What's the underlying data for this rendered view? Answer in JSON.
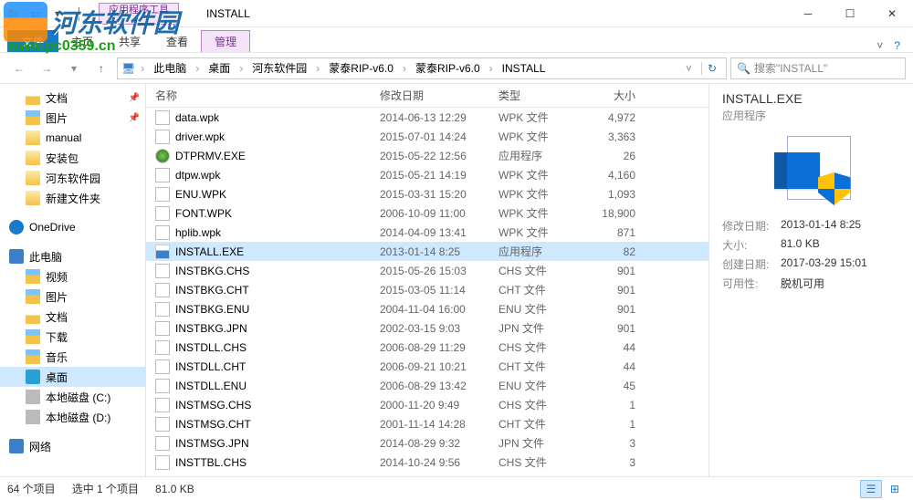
{
  "watermark": {
    "brand": "河东软件园",
    "url": "www.pc0359.cn"
  },
  "titlebar": {
    "context_tab_top": "应用程序工具",
    "window_title": "INSTALL"
  },
  "ribbon": {
    "file": "文件",
    "tabs": [
      "主页",
      "共享",
      "查看"
    ],
    "context_tab": "管理"
  },
  "breadcrumb": {
    "items": [
      "此电脑",
      "桌面",
      "河东软件园",
      "蒙泰RIP-v6.0",
      "蒙泰RIP-v6.0",
      "INSTALL"
    ]
  },
  "search": {
    "placeholder": "搜索\"INSTALL\""
  },
  "tree": {
    "group_quickaccess": [
      {
        "label": "文档",
        "icon": "text-folder",
        "pinned": true
      },
      {
        "label": "图片",
        "icon": "picture-folder",
        "pinned": true
      },
      {
        "label": "manual",
        "icon": "folder-icon",
        "pinned": false
      },
      {
        "label": "安装包",
        "icon": "folder-icon",
        "pinned": false
      },
      {
        "label": "河东软件园",
        "icon": "folder-icon",
        "pinned": false
      },
      {
        "label": "新建文件夹",
        "icon": "folder-icon",
        "pinned": false
      }
    ],
    "onedrive": "OneDrive",
    "thispc": "此电脑",
    "thispc_children": [
      {
        "label": "视频",
        "icon": "video-folder"
      },
      {
        "label": "图片",
        "icon": "picture-folder"
      },
      {
        "label": "文档",
        "icon": "text-folder"
      },
      {
        "label": "下载",
        "icon": "download-folder"
      },
      {
        "label": "音乐",
        "icon": "music-folder"
      },
      {
        "label": "桌面",
        "icon": "desktop-icon",
        "selected": true
      },
      {
        "label": "本地磁盘 (C:)",
        "icon": "disk-icon"
      },
      {
        "label": "本地磁盘 (D:)",
        "icon": "disk-icon"
      }
    ],
    "network": "网络"
  },
  "columns": {
    "name": "名称",
    "date": "修改日期",
    "type": "类型",
    "size": "大小"
  },
  "files": [
    {
      "name": "data.wpk",
      "date": "2014-06-13 12:29",
      "type": "WPK 文件",
      "size": "4,972",
      "icon": "wpk"
    },
    {
      "name": "driver.wpk",
      "date": "2015-07-01 14:24",
      "type": "WPK 文件",
      "size": "3,363",
      "icon": "wpk"
    },
    {
      "name": "DTPRMV.EXE",
      "date": "2015-05-22 12:56",
      "type": "应用程序",
      "size": "26",
      "icon": "dtprmv"
    },
    {
      "name": "dtpw.wpk",
      "date": "2015-05-21 14:19",
      "type": "WPK 文件",
      "size": "4,160",
      "icon": "wpk"
    },
    {
      "name": "ENU.WPK",
      "date": "2015-03-31 15:20",
      "type": "WPK 文件",
      "size": "1,093",
      "icon": "wpk"
    },
    {
      "name": "FONT.WPK",
      "date": "2006-10-09 11:00",
      "type": "WPK 文件",
      "size": "18,900",
      "icon": "wpk"
    },
    {
      "name": "hplib.wpk",
      "date": "2014-04-09 13:41",
      "type": "WPK 文件",
      "size": "871",
      "icon": "wpk"
    },
    {
      "name": "INSTALL.EXE",
      "date": "2013-01-14 8:25",
      "type": "应用程序",
      "size": "82",
      "icon": "exe",
      "selected": true
    },
    {
      "name": "INSTBKG.CHS",
      "date": "2015-05-26 15:03",
      "type": "CHS 文件",
      "size": "901",
      "icon": "wpk"
    },
    {
      "name": "INSTBKG.CHT",
      "date": "2015-03-05 11:14",
      "type": "CHT 文件",
      "size": "901",
      "icon": "wpk"
    },
    {
      "name": "INSTBKG.ENU",
      "date": "2004-11-04 16:00",
      "type": "ENU 文件",
      "size": "901",
      "icon": "wpk"
    },
    {
      "name": "INSTBKG.JPN",
      "date": "2002-03-15 9:03",
      "type": "JPN 文件",
      "size": "901",
      "icon": "wpk"
    },
    {
      "name": "INSTDLL.CHS",
      "date": "2006-08-29 11:29",
      "type": "CHS 文件",
      "size": "44",
      "icon": "wpk"
    },
    {
      "name": "INSTDLL.CHT",
      "date": "2006-09-21 10:21",
      "type": "CHT 文件",
      "size": "44",
      "icon": "wpk"
    },
    {
      "name": "INSTDLL.ENU",
      "date": "2006-08-29 13:42",
      "type": "ENU 文件",
      "size": "45",
      "icon": "wpk"
    },
    {
      "name": "INSTMSG.CHS",
      "date": "2000-11-20 9:49",
      "type": "CHS 文件",
      "size": "1",
      "icon": "wpk"
    },
    {
      "name": "INSTMSG.CHT",
      "date": "2001-11-14 14:28",
      "type": "CHT 文件",
      "size": "1",
      "icon": "wpk"
    },
    {
      "name": "INSTMSG.JPN",
      "date": "2014-08-29 9:32",
      "type": "JPN 文件",
      "size": "3",
      "icon": "wpk"
    },
    {
      "name": "INSTTBL.CHS",
      "date": "2014-10-24 9:56",
      "type": "CHS 文件",
      "size": "3",
      "icon": "wpk"
    }
  ],
  "preview": {
    "title": "INSTALL.EXE",
    "subtitle": "应用程序",
    "rows": [
      {
        "k": "修改日期:",
        "v": "2013-01-14 8:25"
      },
      {
        "k": "大小:",
        "v": "81.0 KB"
      },
      {
        "k": "创建日期:",
        "v": "2017-03-29 15:01"
      },
      {
        "k": "可用性:",
        "v": "脱机可用"
      }
    ]
  },
  "status": {
    "count": "64 个项目",
    "selected": "选中 1 个项目",
    "size": "81.0 KB"
  }
}
